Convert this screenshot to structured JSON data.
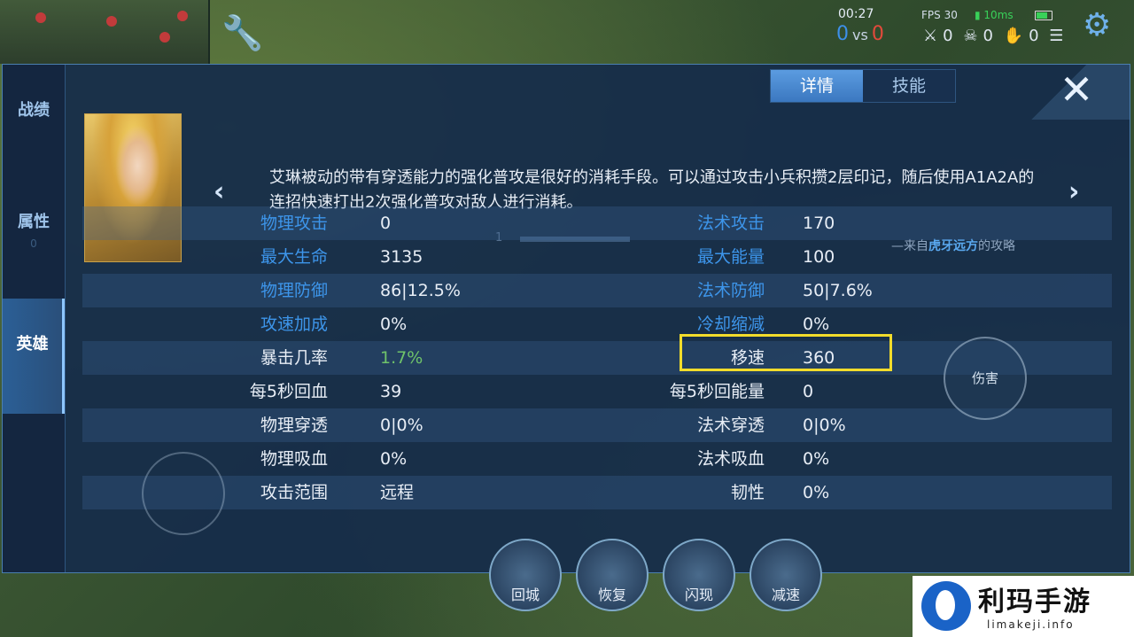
{
  "hud": {
    "time": "00:27",
    "score_blue": "0",
    "vs": "vs",
    "score_red": "0",
    "fps": "FPS 30",
    "ping": "10ms",
    "kills": "0",
    "deaths": "0",
    "assists": "0"
  },
  "side_tabs": [
    {
      "label": "战绩",
      "active": false
    },
    {
      "label": "属性",
      "badge": "0",
      "active": false
    },
    {
      "label": "英雄",
      "active": true
    }
  ],
  "top_tabs": [
    {
      "label": "详情",
      "active": true
    },
    {
      "label": "技能",
      "active": false
    }
  ],
  "tip": {
    "text": "艾琳被动的带有穿透能力的强化普攻是很好的消耗手段。可以通过攻击小兵积攒2层印记，随后使用A1A2A的连招快速打出2次强化普攻对敌人进行消耗。",
    "page": "1",
    "source_prefix": "—来自",
    "source_author": "虎牙远方",
    "source_suffix": "的攻略"
  },
  "stats": [
    {
      "l1": "物理攻击",
      "v1": "0",
      "l2": "法术攻击",
      "v2": "170",
      "c1": "blue",
      "c2": "blue"
    },
    {
      "l1": "最大生命",
      "v1": "3135",
      "l2": "最大能量",
      "v2": "100",
      "c1": "blue",
      "c2": "blue"
    },
    {
      "l1": "物理防御",
      "v1": "86|12.5%",
      "l2": "法术防御",
      "v2": "50|7.6%",
      "c1": "blue",
      "c2": "blue"
    },
    {
      "l1": "攻速加成",
      "v1": "0%",
      "l2": "冷却缩减",
      "v2": "0%",
      "c1": "blue",
      "c2": "blue"
    },
    {
      "l1": "暴击几率",
      "v1": "1.7%",
      "l2": "移速",
      "v2": "360",
      "c1": "white",
      "c2": "white",
      "v1_color": "green"
    },
    {
      "l1": "每5秒回血",
      "v1": "39",
      "l2": "每5秒回能量",
      "v2": "0",
      "c1": "white",
      "c2": "white"
    },
    {
      "l1": "物理穿透",
      "v1": "0|0%",
      "l2": "法术穿透",
      "v2": "0|0%",
      "c1": "white",
      "c2": "white"
    },
    {
      "l1": "物理吸血",
      "v1": "0%",
      "l2": "法术吸血",
      "v2": "0%",
      "c1": "white",
      "c2": "white"
    },
    {
      "l1": "攻击范围",
      "v1": "远程",
      "l2": "韧性",
      "v2": "0%",
      "c1": "white",
      "c2": "white"
    }
  ],
  "skills": [
    "回城",
    "恢复",
    "闪现",
    "减速"
  ],
  "right_buttons": [
    "伤害"
  ],
  "logo": {
    "cn": "利玛手游",
    "en": "limakeji.info"
  }
}
